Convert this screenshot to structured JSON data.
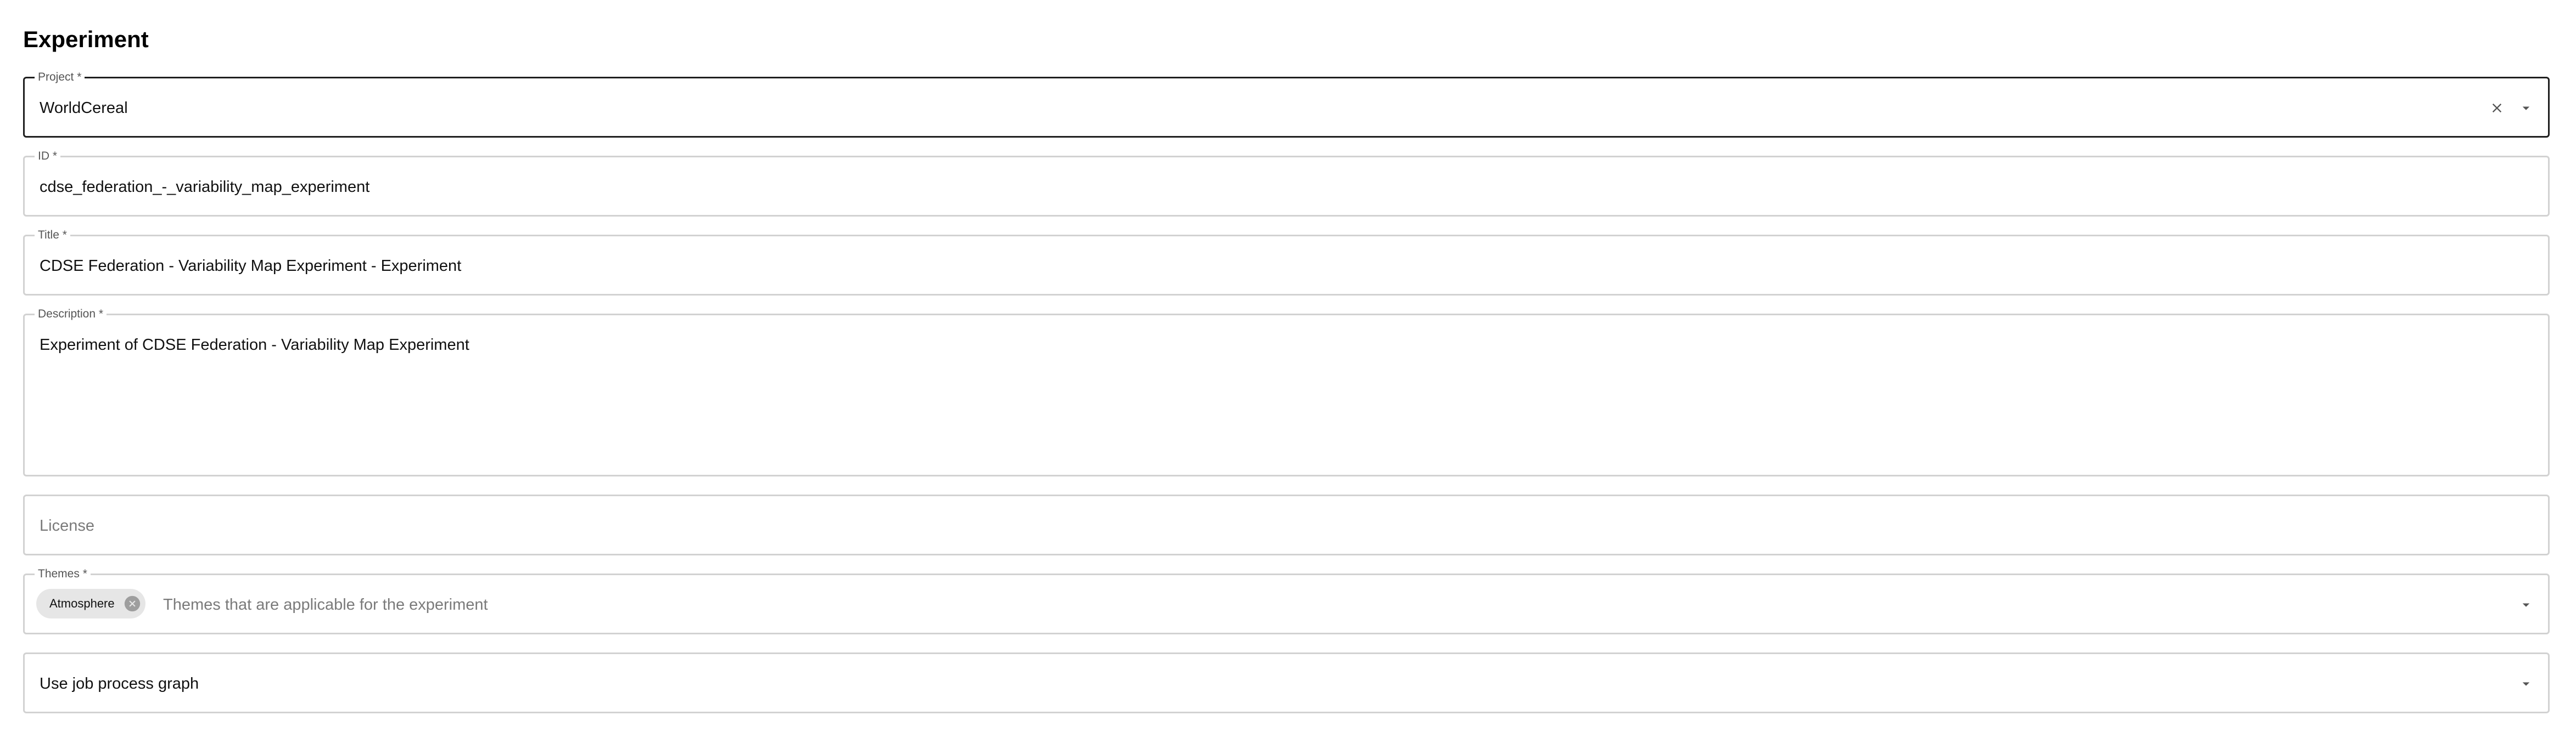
{
  "page": {
    "title": "Experiment"
  },
  "form": {
    "project": {
      "label": "Project *",
      "value": "WorldCereal",
      "clear_icon": "close-icon",
      "dropdown_icon": "arrow-drop-down-icon"
    },
    "id": {
      "label": "ID *",
      "value": "cdse_federation_-_variability_map_experiment"
    },
    "title": {
      "label": "Title *",
      "value": "CDSE Federation - Variability Map Experiment - Experiment"
    },
    "description": {
      "label": "Description *",
      "value": "Experiment of CDSE Federation - Variability Map Experiment"
    },
    "license": {
      "placeholder": "License"
    },
    "themes": {
      "label": "Themes *",
      "chips": [
        "Atmosphere"
      ],
      "chip_delete_icon": "cancel-circle-icon",
      "placeholder": "Themes that are applicable for the experiment",
      "dropdown_icon": "arrow-drop-down-icon"
    },
    "process_graph": {
      "value": "Use job process graph",
      "dropdown_icon": "arrow-drop-down-icon"
    }
  },
  "colors": {
    "border": "#d2d2d2",
    "border_focused": "#1f1f1f",
    "label": "#555555",
    "placeholder": "#7a7a7a",
    "chip_bg": "#e6e6e6",
    "chip_delete": "#9e9e9e",
    "icon": "#555555"
  }
}
